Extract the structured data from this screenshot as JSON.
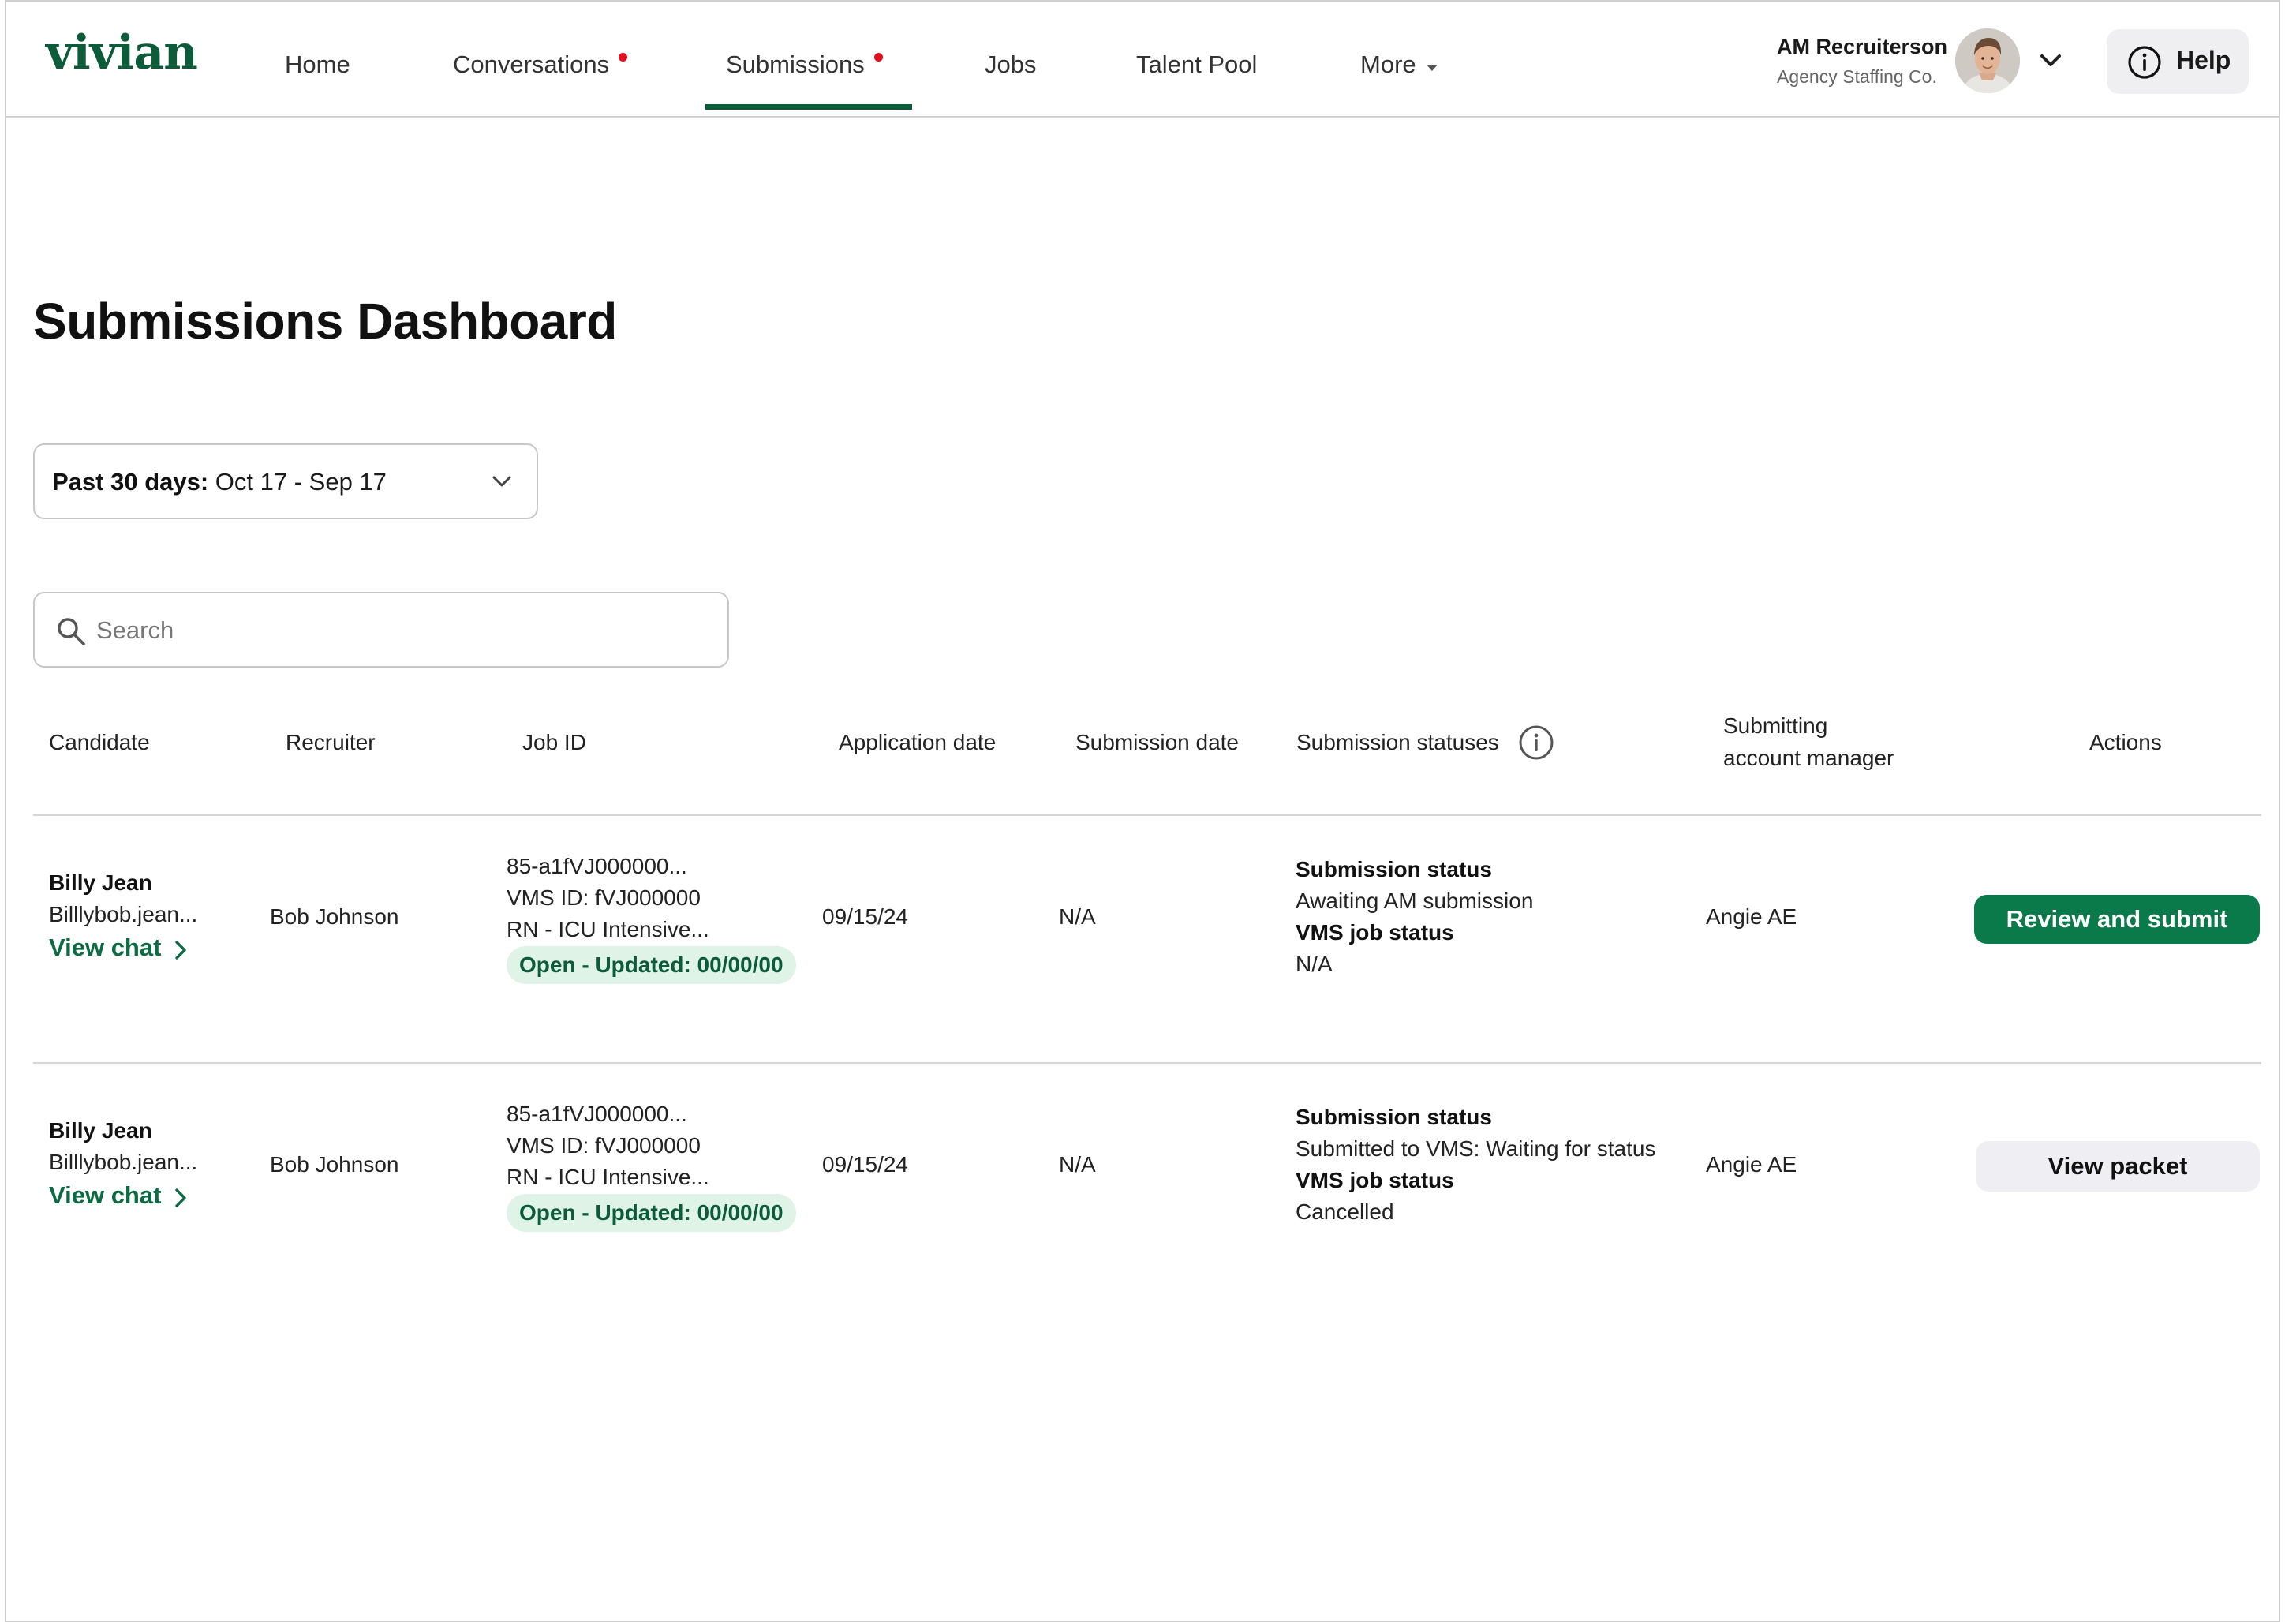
{
  "app": {
    "logo": "vivian"
  },
  "nav": {
    "items": [
      {
        "label": "Home"
      },
      {
        "label": "Conversations",
        "has_notification": true
      },
      {
        "label": "Submissions",
        "has_notification": true,
        "active": true
      },
      {
        "label": "Jobs"
      },
      {
        "label": "Talent Pool"
      },
      {
        "label": "More"
      }
    ]
  },
  "user": {
    "name": "AM Recruiterson",
    "org": "Agency Staffing Co.",
    "help_label": "Help"
  },
  "page": {
    "title": "Submissions Dashboard",
    "date_filter": {
      "prefix": "Past 30 days:",
      "range": "Oct 17 - Sep 17"
    },
    "search": {
      "placeholder": "Search",
      "value": ""
    }
  },
  "table": {
    "headers": {
      "candidate": "Candidate",
      "recruiter": "Recruiter",
      "job_id": "Job ID",
      "application_date": "Application date",
      "submission_date": "Submission date",
      "submission_statuses": "Submission statuses",
      "submitting_am_line1": "Submitting",
      "submitting_am_line2": "account manager",
      "actions": "Actions"
    },
    "rows": [
      {
        "candidate_name": "Billy Jean",
        "candidate_email": "Billlybob.jean...",
        "view_chat": "View chat",
        "recruiter": "Bob Johnson",
        "job_id": "85-a1fVJ000000...",
        "vms_id": "VMS ID: fVJ000000",
        "job_title": "RN - ICU Intensive...",
        "job_status": "Open - Updated: 00/00/00",
        "application_date": "09/15/24",
        "submission_date": "N/A",
        "submission_status_label": "Submission status",
        "submission_status": "Awaiting AM submission",
        "vms_status_label": "VMS job status",
        "vms_status": "N/A",
        "account_manager": "Angie AE",
        "action": "Review and submit"
      },
      {
        "candidate_name": "Billy Jean",
        "candidate_email": "Billlybob.jean...",
        "view_chat": "View chat",
        "recruiter": "Bob Johnson",
        "job_id": "85-a1fVJ000000...",
        "vms_id": "VMS ID: fVJ000000",
        "job_title": "RN - ICU Intensive...",
        "job_status": "Open - Updated: 00/00/00",
        "application_date": "09/15/24",
        "submission_date": "N/A",
        "submission_status_label": "Submission status",
        "submission_status": "Submitted to VMS: Waiting for status",
        "vms_status_label": "VMS job status",
        "vms_status": "Cancelled",
        "account_manager": "Angie AE",
        "action": "View packet"
      }
    ]
  },
  "colors": {
    "brand": "#0c5c3a",
    "primary_button": "#0b7a4b",
    "notification": "#e0101e",
    "pill_bg": "#dff3e6",
    "secondary_button": "#efeff3"
  },
  "icons": {
    "search": "search-icon",
    "info": "info-icon",
    "help": "info-circle-icon",
    "chevron_down": "chevron-down-icon",
    "chevron_right": "chevron-right-icon",
    "caret": "caret-down-icon"
  }
}
